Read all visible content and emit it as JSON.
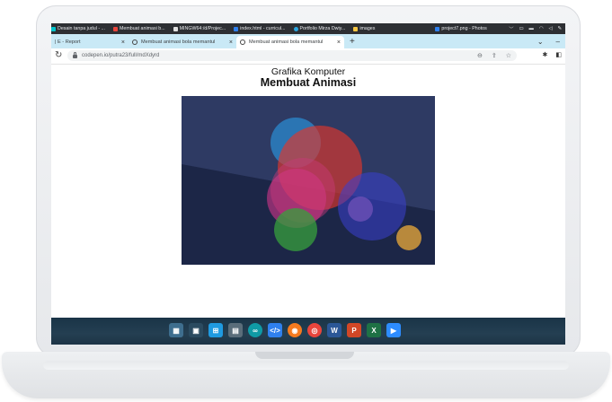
{
  "os_tabs": [
    {
      "label": "Desain tanpa judul - ...",
      "color": "#00c4cc"
    },
    {
      "label": "Membuat animasi b...",
      "color": "#e8453c"
    },
    {
      "label": "MINGW64:/d/Projec...",
      "color": "#e0e0e0"
    },
    {
      "label": "index.html - curricul...",
      "color": "#2f80ed"
    },
    {
      "label": "Portfolio Mirza Dwiy...",
      "color": "#2aa6e0"
    },
    {
      "label": "images",
      "color": "#f5c542"
    },
    {
      "label": "project7.png - Photos",
      "color": "#2f80ed"
    }
  ],
  "browser_tabs": [
    {
      "label": "| E - Report",
      "active": false
    },
    {
      "label": "Membuat animasi bola memantul",
      "active": false
    },
    {
      "label": "Membuat animasi bola memantul",
      "active": true
    }
  ],
  "address": "codepen.io/putra23/full/mdXdyrd",
  "page": {
    "subtitle": "Grafika Komputer",
    "title": "Membuat Animasi"
  },
  "canvas": {
    "bg_top": "#2e3a63",
    "bg_bottom": "#1c2647",
    "balls": [
      {
        "color": "#2b8fd6",
        "opacity": 0.7
      },
      {
        "color": "#e0352b",
        "opacity": 0.65
      },
      {
        "color": "#d2358a",
        "opacity": 0.6
      },
      {
        "color": "#3b3fd0",
        "opacity": 0.55
      },
      {
        "color": "#37a03c",
        "opacity": 0.75
      },
      {
        "color": "#e0a33a",
        "opacity": 0.8
      }
    ]
  },
  "taskbar_icons": [
    "widgets-icon",
    "start-icon",
    "file-explorer-icon",
    "arduino-icon",
    "vscode-icon",
    "firefox-icon",
    "chrome-icon",
    "word-icon",
    "powerpoint-icon",
    "excel-icon",
    "zoom-icon"
  ]
}
